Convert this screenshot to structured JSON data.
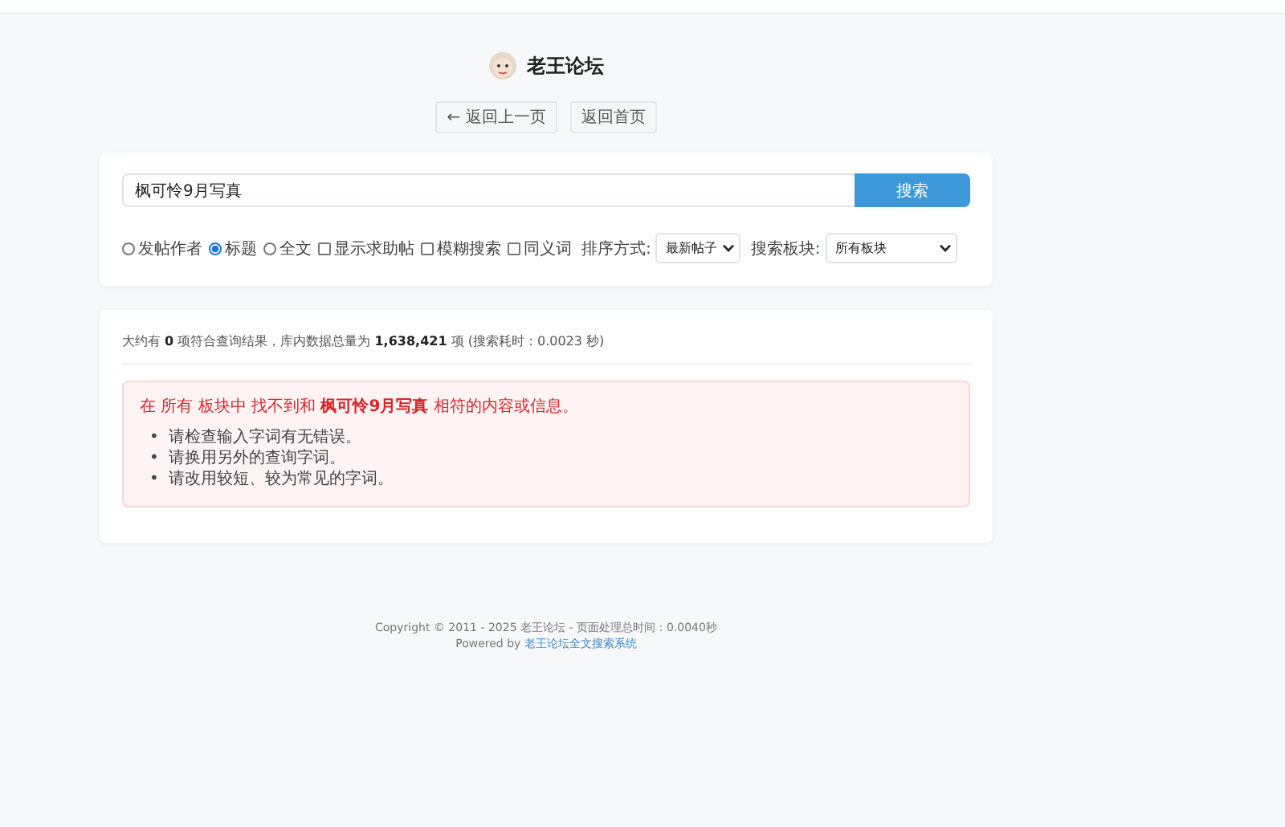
{
  "site": {
    "title": "老王论坛"
  },
  "nav_buttons": [
    "← 返回上一页",
    "返回首页"
  ],
  "search": {
    "value": "枫可怜9月写真",
    "button": "搜索"
  },
  "options": [
    {
      "kind": "radio",
      "label": "发帖作者",
      "selected": false
    },
    {
      "kind": "radio",
      "label": "标题",
      "selected": true
    },
    {
      "kind": "radio",
      "label": "全文",
      "selected": false
    },
    {
      "kind": "checkbox",
      "label": "显示求助帖",
      "checked": false
    },
    {
      "kind": "checkbox",
      "label": "模糊搜索",
      "checked": false
    },
    {
      "kind": "checkbox",
      "label": "同义词",
      "checked": false
    },
    {
      "kind": "select",
      "label": "排序方式:",
      "value": "最新帖子"
    },
    {
      "kind": "select",
      "label": "搜索板块:",
      "value": "所有板块"
    }
  ],
  "results": {
    "summary": "大约有 **0** 项符合查询结果，库内数据总量为 **1,638,421** 项 (搜索耗时：0.0023 秒)",
    "notice": {
      "title": "在 所有 板块中 找不到和 **枫可怜9月写真** 相符的内容或信息。",
      "bullet": "•",
      "tips": [
        "请检查输入字词有无错误。",
        "请换用另外的查询字词。",
        "请改用较短、较为常见的字词。"
      ]
    }
  },
  "footer": {
    "copyright": "Copyright © 2011 - 2025 老王论坛 - 页面处理总时间：0.0040秒",
    "powered_by": "Powered by",
    "link": "老王论坛全文搜索系统"
  }
}
